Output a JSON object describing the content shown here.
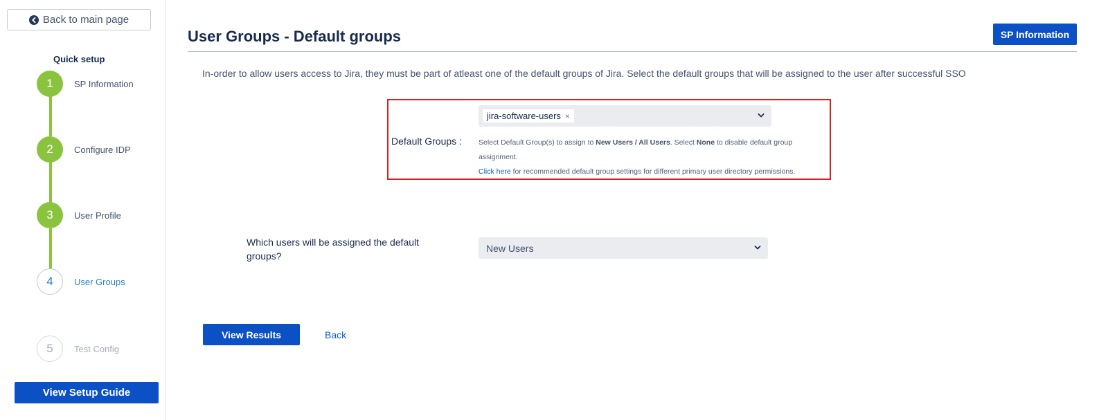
{
  "sidebar": {
    "back_label": "Back to main page",
    "quick_setup_title": "Quick setup",
    "steps": [
      {
        "number": "1",
        "label": "SP Information",
        "state": "done"
      },
      {
        "number": "2",
        "label": "Configure IDP",
        "state": "done"
      },
      {
        "number": "3",
        "label": "User Profile",
        "state": "done"
      },
      {
        "number": "4",
        "label": "User Groups",
        "state": "active"
      },
      {
        "number": "5",
        "label": "Test Config",
        "state": "pending"
      }
    ],
    "guide_label": "View Setup Guide"
  },
  "header": {
    "title": "User Groups - Default groups",
    "sp_info_label": "SP Information"
  },
  "intro_text": "In-order to allow users access to Jira, they must be part of atleast one of the default groups of Jira. Select the default groups that will be assigned to the user after successful SSO",
  "default_groups": {
    "label": "Default Groups :",
    "selected_tags": [
      "jira-software-users"
    ],
    "remove_glyph": "×",
    "help_part1": "Select Default Group(s) to assign to ",
    "help_bold1": "New Users / All Users",
    "help_part2": ". Select ",
    "help_bold2": "None",
    "help_part3": " to disable default group assignment.",
    "help_link": "Click here",
    "help_part4": " for recommended default group settings for different primary user directory permissions."
  },
  "assign_users": {
    "question": "Which users will be assigned the default groups?",
    "selected_value": "New Users"
  },
  "actions": {
    "view_results_label": "View Results",
    "back_label": "Back"
  },
  "colors": {
    "primary_button": "#0b50c5",
    "step_done": "#8ac43f",
    "highlight_border": "#d72121",
    "link": "#0b5fc4"
  },
  "icons": {
    "back": "arrow-left-circle-icon",
    "dropdown": "chevron-down-icon",
    "remove_tag": "close-icon"
  }
}
